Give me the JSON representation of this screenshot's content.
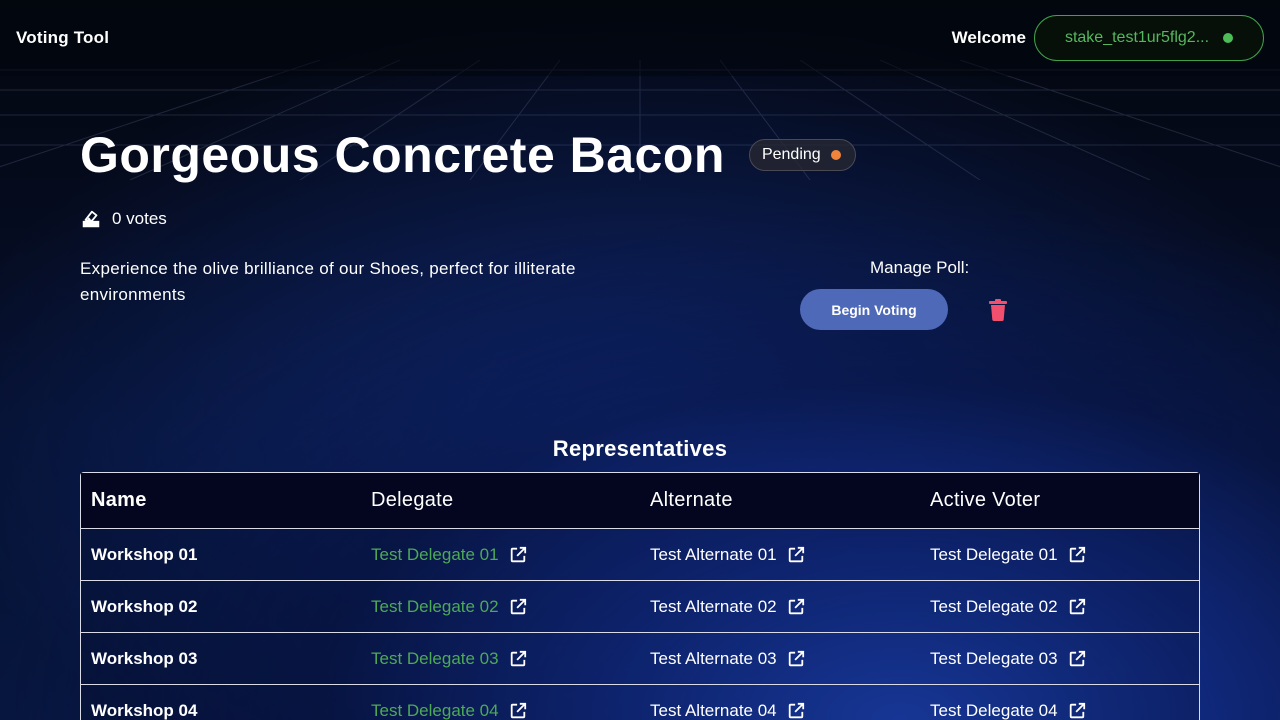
{
  "header": {
    "app_title": "Voting Tool",
    "welcome": "Welcome",
    "wallet_address": "stake_test1ur5flg2..."
  },
  "poll": {
    "title": "Gorgeous Concrete Bacon",
    "status": "Pending",
    "votes": "0 votes",
    "description": "Experience the olive brilliance of our Shoes, perfect for illiterate environments"
  },
  "manage": {
    "label": "Manage Poll:",
    "begin_label": "Begin Voting"
  },
  "representatives": {
    "title": "Representatives",
    "columns": [
      "Name",
      "Delegate",
      "Alternate",
      "Active Voter"
    ],
    "rows": [
      {
        "name": "Workshop 01",
        "delegate": "Test Delegate 01",
        "alternate": "Test Alternate 01",
        "active_voter": "Test Delegate 01"
      },
      {
        "name": "Workshop 02",
        "delegate": "Test Delegate 02",
        "alternate": "Test Alternate 02",
        "active_voter": "Test Delegate 02"
      },
      {
        "name": "Workshop 03",
        "delegate": "Test Delegate 03",
        "alternate": "Test Alternate 03",
        "active_voter": "Test Delegate 03"
      },
      {
        "name": "Workshop 04",
        "delegate": "Test Delegate 04",
        "alternate": "Test Alternate 04",
        "active_voter": "Test Delegate 04"
      }
    ]
  },
  "colors": {
    "accent_green": "#4ea957",
    "status_pending": "#f0843c",
    "primary_button": "#4e69b8",
    "delete_red": "#f0506e"
  },
  "icons": {
    "votes": "ballot-box-icon",
    "delete": "trash-icon",
    "link": "external-link-icon",
    "wallet_status": "connected-dot-icon"
  }
}
